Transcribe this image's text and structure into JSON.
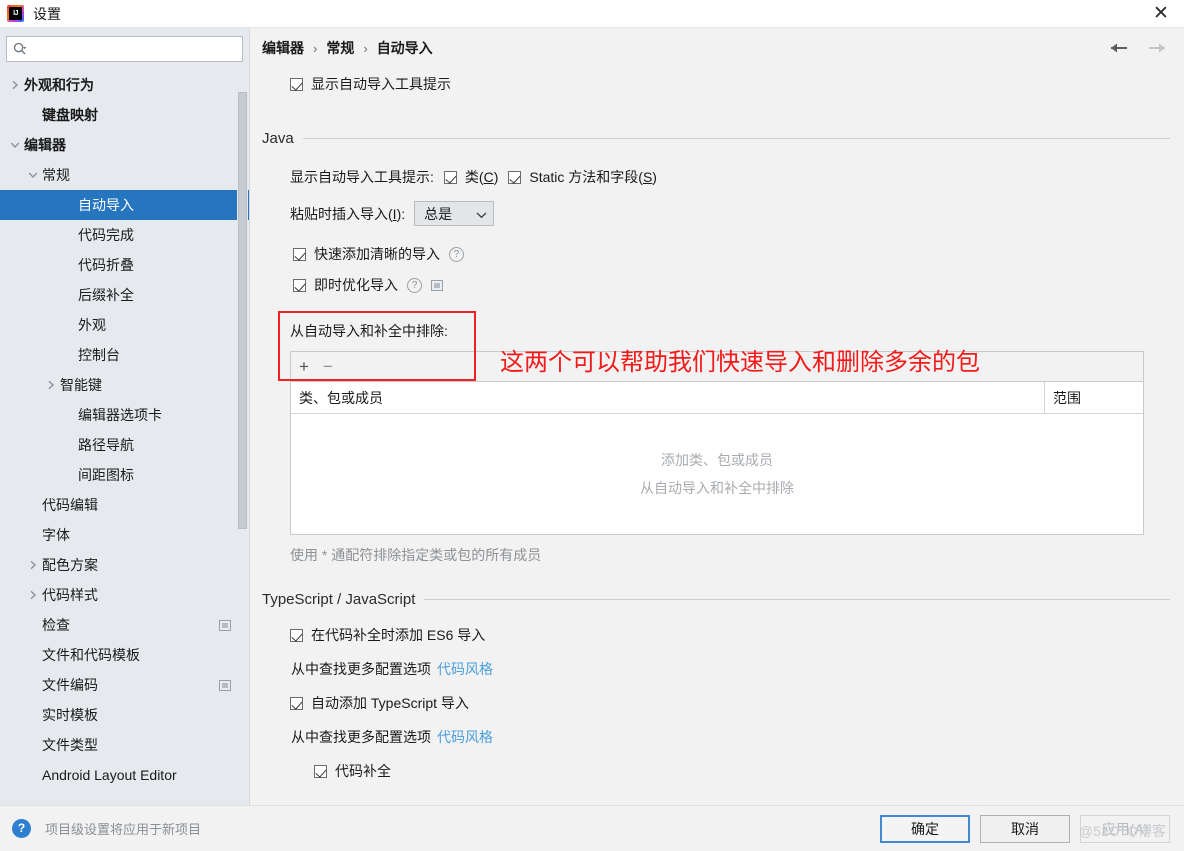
{
  "window": {
    "title": "设置",
    "app_icon": "intellij-idea-icon",
    "close_label": "✕"
  },
  "sidebar": {
    "search": {
      "placeholder": "",
      "value": "",
      "icon": "search-icon"
    },
    "items": [
      {
        "label": "外观和行为",
        "indent": 0,
        "twisty": "right",
        "bold": true,
        "selected": false,
        "badge": false
      },
      {
        "label": "键盘映射",
        "indent": 1,
        "twisty": "none",
        "bold": true,
        "selected": false,
        "badge": false
      },
      {
        "label": "编辑器",
        "indent": 0,
        "twisty": "down",
        "bold": true,
        "selected": false,
        "badge": false
      },
      {
        "label": "常规",
        "indent": 1,
        "twisty": "down",
        "bold": false,
        "selected": false,
        "badge": false
      },
      {
        "label": "自动导入",
        "indent": 3,
        "twisty": "none",
        "bold": false,
        "selected": true,
        "badge": false
      },
      {
        "label": "代码完成",
        "indent": 3,
        "twisty": "none",
        "bold": false,
        "selected": false,
        "badge": false
      },
      {
        "label": "代码折叠",
        "indent": 3,
        "twisty": "none",
        "bold": false,
        "selected": false,
        "badge": false
      },
      {
        "label": "后缀补全",
        "indent": 3,
        "twisty": "none",
        "bold": false,
        "selected": false,
        "badge": false
      },
      {
        "label": "外观",
        "indent": 3,
        "twisty": "none",
        "bold": false,
        "selected": false,
        "badge": false
      },
      {
        "label": "控制台",
        "indent": 3,
        "twisty": "none",
        "bold": false,
        "selected": false,
        "badge": false
      },
      {
        "label": "智能键",
        "indent": 2,
        "twisty": "right",
        "bold": false,
        "selected": false,
        "badge": false
      },
      {
        "label": "编辑器选项卡",
        "indent": 3,
        "twisty": "none",
        "bold": false,
        "selected": false,
        "badge": false
      },
      {
        "label": "路径导航",
        "indent": 3,
        "twisty": "none",
        "bold": false,
        "selected": false,
        "badge": false
      },
      {
        "label": "间距图标",
        "indent": 3,
        "twisty": "none",
        "bold": false,
        "selected": false,
        "badge": false
      },
      {
        "label": "代码编辑",
        "indent": 1,
        "twisty": "none",
        "bold": false,
        "selected": false,
        "badge": false
      },
      {
        "label": "字体",
        "indent": 1,
        "twisty": "none",
        "bold": false,
        "selected": false,
        "badge": false
      },
      {
        "label": "配色方案",
        "indent": 1,
        "twisty": "right",
        "bold": false,
        "selected": false,
        "badge": false
      },
      {
        "label": "代码样式",
        "indent": 1,
        "twisty": "right",
        "bold": false,
        "selected": false,
        "badge": false
      },
      {
        "label": "检查",
        "indent": 1,
        "twisty": "none",
        "bold": false,
        "selected": false,
        "badge": true
      },
      {
        "label": "文件和代码模板",
        "indent": 1,
        "twisty": "none",
        "bold": false,
        "selected": false,
        "badge": false
      },
      {
        "label": "文件编码",
        "indent": 1,
        "twisty": "none",
        "bold": false,
        "selected": false,
        "badge": true
      },
      {
        "label": "实时模板",
        "indent": 1,
        "twisty": "none",
        "bold": false,
        "selected": false,
        "badge": false
      },
      {
        "label": "文件类型",
        "indent": 1,
        "twisty": "none",
        "bold": false,
        "selected": false,
        "badge": false
      },
      {
        "label": "Android Layout Editor",
        "indent": 1,
        "twisty": "none",
        "bold": false,
        "selected": false,
        "badge": false
      }
    ]
  },
  "breadcrumb": {
    "items": [
      "编辑器",
      "常规",
      "自动导入"
    ],
    "separator": "›",
    "back_icon": "arrow-left-icon",
    "forward_icon": "arrow-right-icon"
  },
  "main": {
    "top_checkbox": {
      "label": "显示自动导入工具提示",
      "checked": true
    },
    "java_section": {
      "title": "Java",
      "tooltip_row_label": "显示自动导入工具提示:",
      "tooltip_checkboxes": [
        {
          "label": "类(C)",
          "underline": "C",
          "checked": true
        },
        {
          "label": "Static 方法和字段(S)",
          "underline": "S",
          "checked": true
        }
      ],
      "paste_label": "粘贴时插入导入(I):",
      "paste_value": "总是",
      "paste_caret": "chevron-down-icon",
      "highlighted_checkboxes": [
        {
          "label": "快速添加清晰的导入",
          "checked": true,
          "help": true,
          "mini": false
        },
        {
          "label": "即时优化导入",
          "checked": true,
          "help": true,
          "mini": true
        }
      ],
      "exclude_label": "从自动导入和补全中排除:",
      "table": {
        "toolbar": {
          "add": "+",
          "remove": "−"
        },
        "columns": [
          "类、包或成员",
          "范围"
        ],
        "rows": [],
        "empty_lines": [
          "添加类、包或成员",
          "从自动导入和补全中排除"
        ]
      },
      "wildcard_hint": "使用 * 通配符排除指定类或包的所有成员"
    },
    "ts_section": {
      "title": "TypeScript / JavaScript",
      "rows": [
        {
          "type": "checkbox",
          "label": "在代码补全时添加 ES6 导入",
          "checked": true,
          "indent": 0
        },
        {
          "type": "hint",
          "text": "从中查找更多配置选项",
          "link": "代码风格"
        },
        {
          "type": "checkbox",
          "label": "自动添加 TypeScript 导入",
          "checked": true,
          "indent": 0
        },
        {
          "type": "hint",
          "text": "从中查找更多配置选项",
          "link": "代码风格"
        },
        {
          "type": "checkbox",
          "label": "代码补全",
          "checked": true,
          "indent": 1
        }
      ]
    },
    "annotation": {
      "text": "这两个可以帮助我们快速导入和删除多余的包",
      "color": "#f31a1a",
      "box_color": "#ee2222"
    }
  },
  "footer": {
    "help_icon": "question-mark-icon",
    "note": "项目级设置将应用于新项目",
    "buttons": [
      {
        "label": "确定",
        "style": "default",
        "enabled": true
      },
      {
        "label": "取消",
        "style": "normal",
        "enabled": true
      },
      {
        "label": "应用(A)",
        "style": "disabled",
        "enabled": false
      }
    ],
    "watermark": "@51CTO博客"
  },
  "colors": {
    "selection_blue": "#2675bf",
    "link_blue": "#4a9edd",
    "accent_red": "#f31a1a",
    "sidebar_bg": "#e6eaee",
    "panel_bg": "#f2f2f2"
  }
}
